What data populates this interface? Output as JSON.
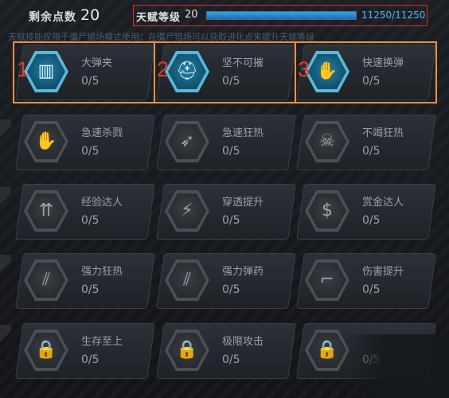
{
  "header": {
    "points_label": "剩余点数",
    "points_value": "20",
    "level_label": "天赋等级",
    "level_value": "20",
    "xp_text": "11250/11250",
    "xp_progress": 1.0,
    "xp_color": "#3aa0e6"
  },
  "note": "天赋技能仅限于僵尸猎场模式使用；在僵尸猎场可以获取进化点来提升天赋等级",
  "highlights": [
    "1",
    "2",
    "3"
  ],
  "skills": [
    {
      "name": "大弹夹",
      "level": "0/5",
      "icon": "magazine-icon",
      "glyph": "▥",
      "active": true
    },
    {
      "name": "坚不可摧",
      "level": "0/5",
      "icon": "helmet-icon",
      "glyph": "⛑",
      "active": true
    },
    {
      "name": "快速换弹",
      "level": "0/5",
      "icon": "hand-reload-icon",
      "glyph": "✋",
      "active": true
    },
    {
      "name": "急速杀戮",
      "level": "0/5",
      "icon": "claw-hand-icon",
      "glyph": "✋",
      "active": false
    },
    {
      "name": "急速狂热",
      "level": "0/5",
      "icon": "bullet-spin-icon",
      "glyph": "➶",
      "active": false
    },
    {
      "name": "不竭狂热",
      "level": "0/5",
      "icon": "skull-icon",
      "glyph": "☠",
      "active": false
    },
    {
      "name": "经验达人",
      "level": "0/5",
      "icon": "exp-plus-icon",
      "glyph": "⇈",
      "active": false
    },
    {
      "name": "穿透提升",
      "level": "0/5",
      "icon": "penetration-icon",
      "glyph": "⚡",
      "active": false
    },
    {
      "name": "赏金达人",
      "level": "0/5",
      "icon": "dollar-icon",
      "glyph": "$",
      "active": false
    },
    {
      "name": "强力狂热",
      "level": "0/5",
      "icon": "power-fever-icon",
      "glyph": "⫽",
      "active": false
    },
    {
      "name": "强力弹药",
      "level": "0/5",
      "icon": "power-ammo-icon",
      "glyph": "⫽",
      "active": false
    },
    {
      "name": "伤害提升",
      "level": "0/5",
      "icon": "gun-icon",
      "glyph": "⌐",
      "active": false
    },
    {
      "name": "生存至上",
      "level": "0/5",
      "icon": "lock-icon",
      "glyph": "🔒",
      "active": false
    },
    {
      "name": "极限攻击",
      "level": "0/5",
      "icon": "lock-icon",
      "glyph": "🔒",
      "active": false
    },
    {
      "name": "",
      "level": "0/5",
      "icon": "lock-icon",
      "glyph": "🔒",
      "active": false
    }
  ]
}
